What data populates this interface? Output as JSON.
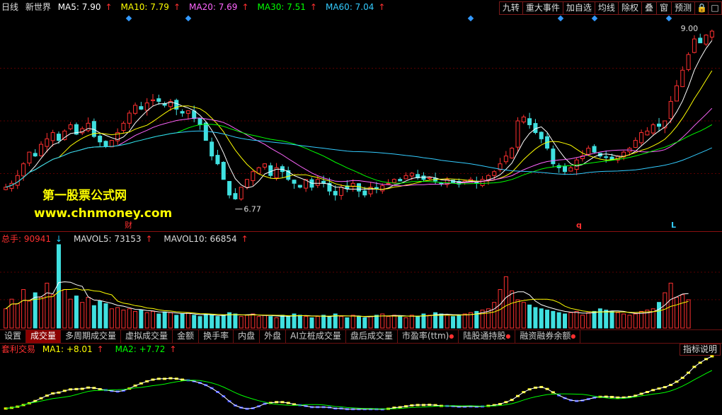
{
  "price_panel": {
    "period": "日线",
    "stock_name": "新世界",
    "ma": [
      {
        "label": "MA5: 7.90",
        "color": "#ffffff"
      },
      {
        "label": "MA10: 7.79",
        "color": "#ffff00"
      },
      {
        "label": "MA20: 7.69",
        "color": "#ff66ff"
      },
      {
        "label": "MA30: 7.51",
        "color": "#00ff00"
      },
      {
        "label": "MA60: 7.04",
        "color": "#33ccff"
      }
    ],
    "high_label": "9.00",
    "low_label": "6.77",
    "markers": [
      "财",
      "q",
      "L"
    ]
  },
  "toolbar": [
    "九转",
    "重大事件",
    "加自选",
    "均线",
    "除权",
    "叠",
    "窗",
    "预测"
  ],
  "volume_panel": {
    "total": "总手: 90941",
    "mavol5": "MAVOL5: 73153",
    "mavol10": "MAVOL10: 66854"
  },
  "tabs": [
    "设置",
    "成交量",
    "多周期成交量",
    "虚拟成交量",
    "金额",
    "换手率",
    "内盘",
    "外盘",
    "AI立桩成交量",
    "盘后成交量",
    "市盈率(ttm)",
    "陆股通持股",
    "融资融券余额"
  ],
  "indicator": {
    "name": "套利交易",
    "ma1": "MA1: +8.01",
    "ma2": "MA2: +7.72",
    "help": "指标说明"
  },
  "watermark": {
    "line1": "第一股票公式网",
    "line2": "www.chnmoney.com"
  },
  "chart_data": {
    "type": "candlestick",
    "y_range": [
      6.5,
      9.2
    ],
    "closes": [
      7.0,
      7.05,
      7.15,
      7.3,
      7.45,
      7.4,
      7.55,
      7.62,
      7.7,
      7.6,
      7.72,
      7.8,
      7.68,
      7.75,
      7.82,
      7.65,
      7.58,
      7.52,
      7.6,
      7.7,
      7.82,
      7.95,
      8.05,
      8.0,
      8.08,
      8.12,
      8.1,
      8.05,
      8.1,
      8.0,
      7.95,
      7.98,
      7.88,
      7.8,
      7.6,
      7.4,
      7.3,
      7.1,
      6.9,
      6.85,
      7.0,
      7.1,
      7.2,
      7.25,
      7.3,
      7.15,
      7.25,
      7.2,
      7.1,
      7.05,
      7.0,
      7.1,
      7.0,
      7.1,
      7.05,
      6.95,
      6.9,
      7.0,
      6.98,
      7.05,
      6.95,
      6.9,
      7.0,
      6.98,
      7.02,
      7.05,
      7.1,
      7.08,
      7.15,
      7.18,
      7.12,
      7.1,
      7.12,
      7.08,
      7.05,
      7.1,
      7.06,
      7.04,
      7.08,
      7.1,
      7.05,
      7.1,
      7.15,
      7.2,
      7.3,
      7.4,
      7.5,
      7.85,
      7.9,
      7.8,
      7.7,
      7.62,
      7.5,
      7.3,
      7.25,
      7.2,
      7.25,
      7.35,
      7.4,
      7.5,
      7.45,
      7.4,
      7.38,
      7.35,
      7.4,
      7.45,
      7.5,
      7.6,
      7.7,
      7.72,
      7.8,
      7.78,
      7.85,
      8.1,
      8.3,
      8.5,
      8.7,
      8.9,
      8.85,
      8.95,
      9.0
    ],
    "volumes": [
      30,
      45,
      38,
      60,
      42,
      55,
      48,
      70,
      52,
      130,
      60,
      45,
      50,
      40,
      48,
      35,
      42,
      38,
      30,
      32,
      28,
      30,
      26,
      28,
      24,
      26,
      22,
      25,
      24,
      20,
      22,
      24,
      20,
      18,
      22,
      20,
      18,
      20,
      24,
      22,
      18,
      20,
      22,
      18,
      20,
      18,
      16,
      20,
      18,
      22,
      20,
      18,
      16,
      18,
      20,
      18,
      22,
      18,
      16,
      20,
      18,
      16,
      18,
      20,
      22,
      18,
      20,
      18,
      16,
      20,
      18,
      22,
      20,
      24,
      22,
      20,
      18,
      20,
      22,
      24,
      26,
      28,
      30,
      40,
      60,
      80,
      58,
      44,
      40,
      36,
      32,
      30,
      28,
      26,
      24,
      22,
      24,
      26,
      20,
      24,
      26,
      30,
      28,
      26,
      24,
      22,
      20,
      22,
      26,
      28,
      30,
      40,
      55,
      70,
      48,
      52,
      44
    ],
    "ma1_last": 8.01,
    "ma2_last": 7.72
  }
}
